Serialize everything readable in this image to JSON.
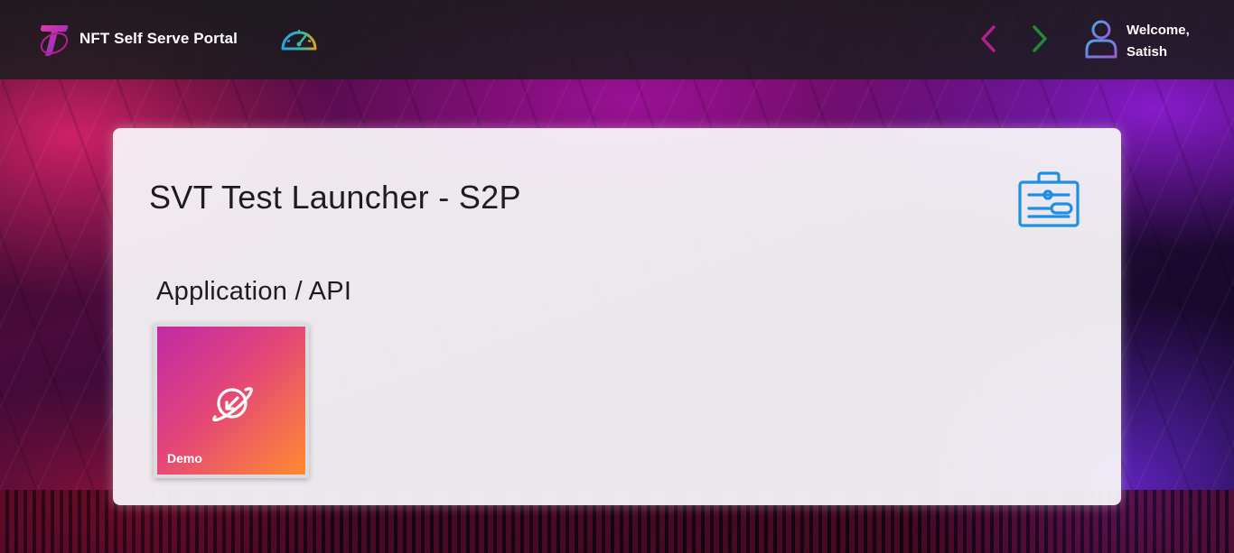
{
  "header": {
    "app_title": "NFT Self Serve Portal",
    "logo_icon": "telstra-logo-icon",
    "dashboard_icon": "speedometer-icon",
    "back_icon": "chevron-left-icon",
    "forward_icon": "chevron-right-icon",
    "user_icon": "user-icon",
    "welcome_line1": "Welcome,",
    "welcome_line2": "Satish"
  },
  "panel": {
    "title": "SVT Test Launcher - S2P",
    "tool_icon": "toolbox-icon",
    "section_title": "Application / API",
    "tiles": [
      {
        "label": "Demo",
        "icon": "planet-arrow-icon"
      }
    ]
  },
  "colors": {
    "back_arrow": "#b0208f",
    "forward_arrow": "#1f8a3a",
    "tool_icon": "#1f8fe0",
    "tile_gradient_start": "#c02aa6",
    "tile_gradient_end": "#ff8a30"
  }
}
